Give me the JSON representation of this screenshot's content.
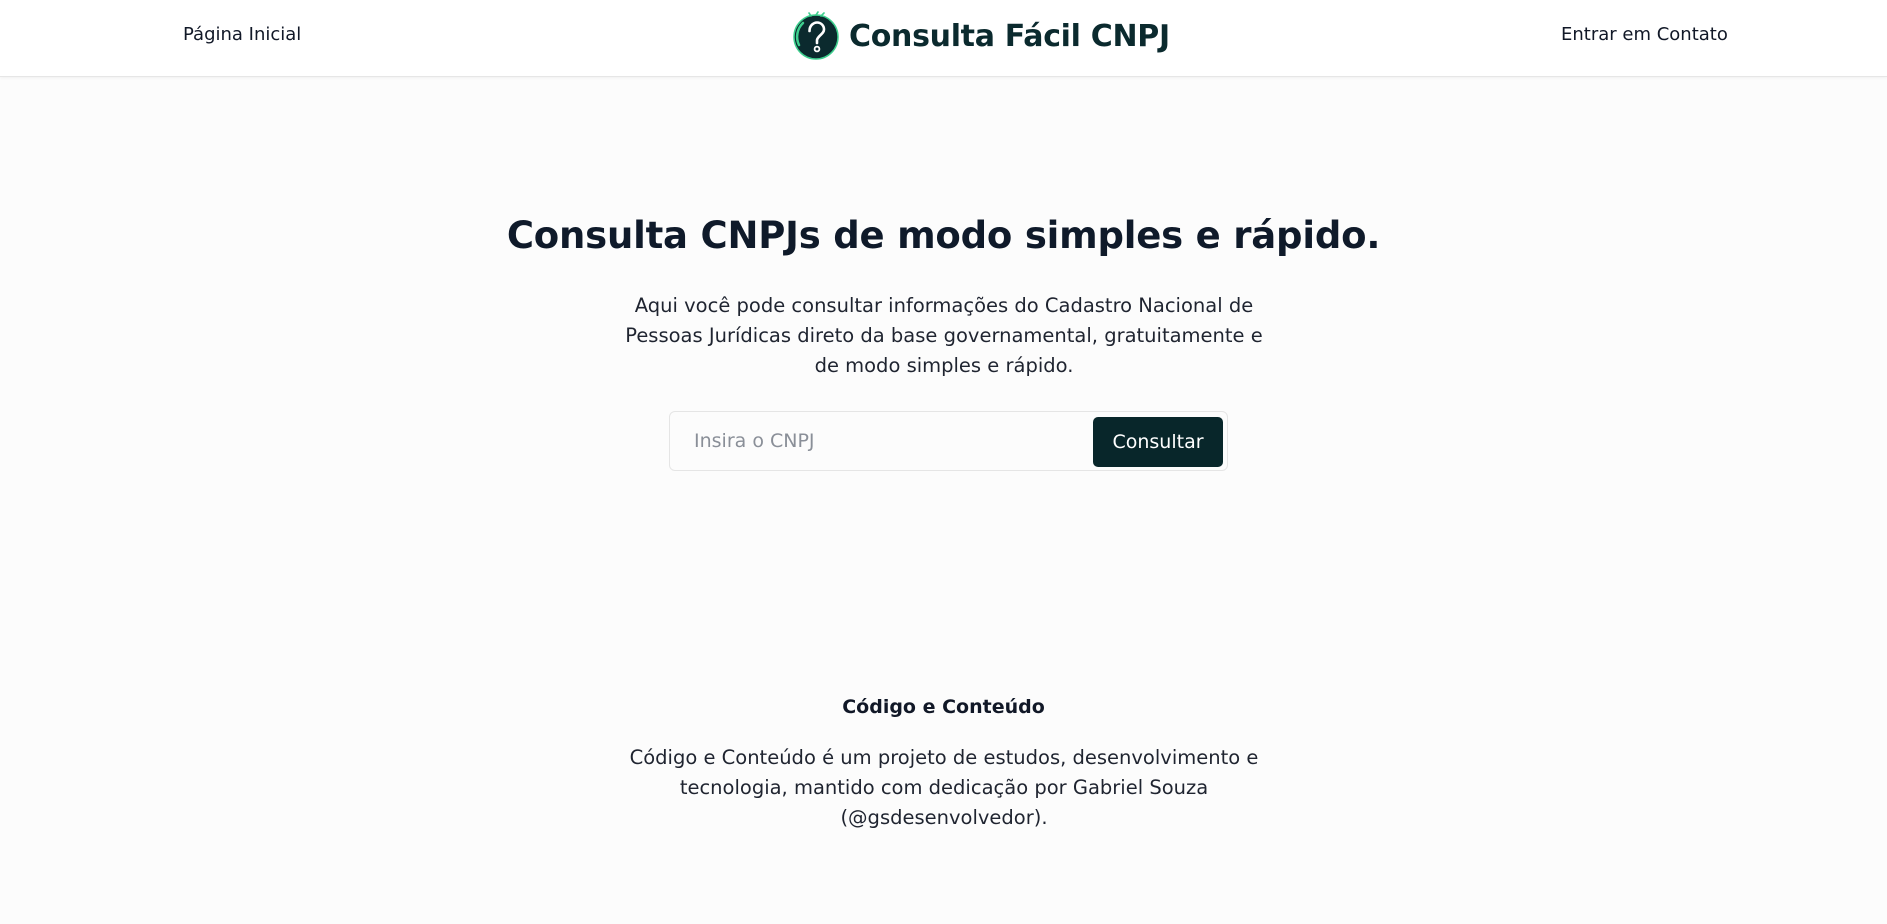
{
  "header": {
    "nav_home": "Página Inicial",
    "brand_name": "Consulta Fácil CNPJ",
    "brand_icon": "question-mark-icon",
    "nav_contact": "Entrar em Contato"
  },
  "hero": {
    "title": "Consulta CNPJs de modo simples e rápido.",
    "description": "Aqui você pode consultar informações do Cadastro Nacional de Pessoas Jurídicas direto da base governamental, gratuitamente e de modo simples e rápido."
  },
  "search": {
    "value": "",
    "placeholder": "Insira o CNPJ",
    "button_label": "Consultar"
  },
  "footer": {
    "title": "Código e Conteúdo",
    "text": "Código e Conteúdo é um projeto de estudos, desenvolvimento e tecnologia, mantido com dedicação por Gabriel Souza (@gsdesenvolvedor)."
  },
  "colors": {
    "brand": "#0b2a2e",
    "accent": "#3ecf8e",
    "button_bg": "#08262a",
    "page_bg": "#fcfcfc"
  }
}
